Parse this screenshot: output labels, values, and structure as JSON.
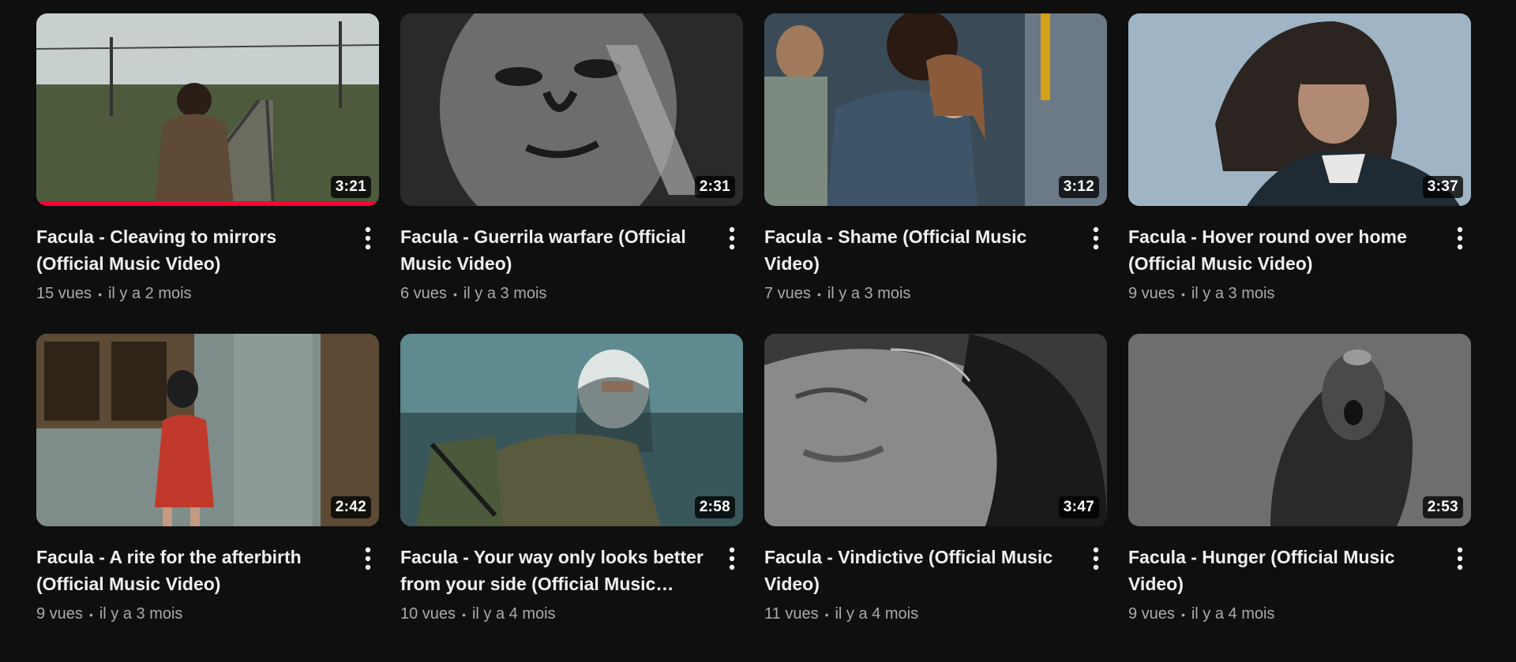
{
  "videos": [
    {
      "title": "Facula - Cleaving to mirrors (Official Music Video)",
      "duration": "3:21",
      "views": "15 vues",
      "age": "il y a 2 mois",
      "watched_fraction": 1.0,
      "scene": "railway-tracks",
      "palette": [
        "#7a8f91",
        "#4d5a3c",
        "#5e4a36",
        "#c8d0cf"
      ]
    },
    {
      "title": "Facula - Guerrila warfare (Official Music Video)",
      "duration": "2:31",
      "views": "6 vues",
      "age": "il y a 3 mois",
      "watched_fraction": 0,
      "scene": "charcoal-face",
      "palette": [
        "#2a2a2a",
        "#6d6d6d",
        "#1a1a1a",
        "#a9a9a9"
      ]
    },
    {
      "title": "Facula - Shame (Official Music Video)",
      "duration": "3:12",
      "views": "7 vues",
      "age": "il y a 3 mois",
      "watched_fraction": 0,
      "scene": "couple-embrace",
      "palette": [
        "#55635f",
        "#3b4a57",
        "#c9a48a",
        "#8a5a3a"
      ]
    },
    {
      "title": "Facula - Hover round over home (Official Music Video)",
      "duration": "3:37",
      "views": "9 vues",
      "age": "il y a 3 mois",
      "watched_fraction": 0,
      "scene": "long-hair-man",
      "palette": [
        "#9fb4c4",
        "#2b2420",
        "#1f2a33",
        "#e6e6e6"
      ]
    },
    {
      "title": "Facula - A rite for the afterbirth (Official Music Video)",
      "duration": "2:42",
      "views": "9 vues",
      "age": "il y a 3 mois",
      "watched_fraction": 0,
      "scene": "woman-wall",
      "palette": [
        "#7f8d8a",
        "#5c4a34",
        "#c0392b",
        "#3a3a3a"
      ]
    },
    {
      "title": "Facula - Your way only looks better from your side (Official Music Video)",
      "duration": "2:58",
      "views": "10 vues",
      "age": "il y a 4 mois",
      "watched_fraction": 0,
      "scene": "keffiyeh-soldier",
      "palette": [
        "#5f8a90",
        "#2f4a4d",
        "#5a5a3e",
        "#cfd8d8"
      ]
    },
    {
      "title": "Facula - Vindictive (Official Music Video)",
      "duration": "3:47",
      "views": "11 vues",
      "age": "il y a 4 mois",
      "watched_fraction": 0,
      "scene": "face-closeup",
      "palette": [
        "#3a3a3a",
        "#8a8a8a",
        "#1a1a1a",
        "#bdbdbd"
      ]
    },
    {
      "title": "Facula - Hunger (Official Music Video)",
      "duration": "2:53",
      "views": "9 vues",
      "age": "il y a 4 mois",
      "watched_fraction": 0,
      "scene": "statue-head",
      "palette": [
        "#6e6e6e",
        "#2a2a2a",
        "#4a4a4a",
        "#9a9a9a"
      ]
    }
  ],
  "icons": {
    "menu": "more-vert-icon",
    "separator": "•"
  }
}
